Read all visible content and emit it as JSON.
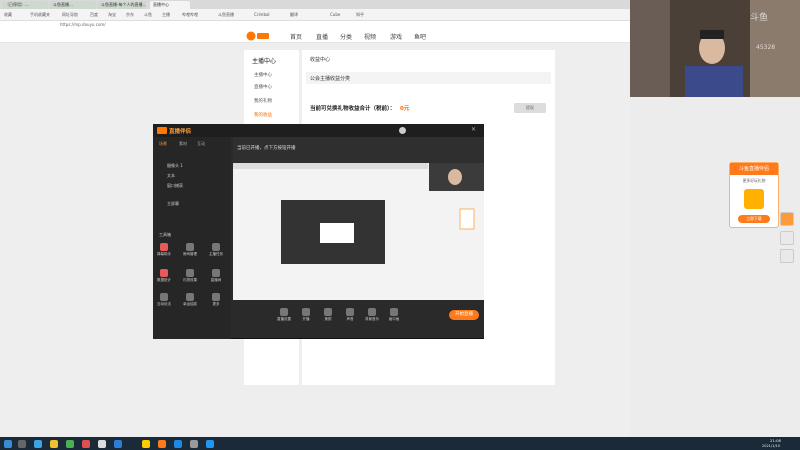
{
  "browser": {
    "tabs": [
      "（已停用）...",
      "斗鱼直播...",
      "斗鱼直播-每个人的直播...",
      "直播中心"
    ],
    "bookmarks": [
      "收藏",
      "手机收藏夹",
      "网址导航",
      "百度",
      "淘宝",
      "京东",
      "斗鱼",
      "主播",
      "哔哩哔哩",
      "斗鱼直播",
      "Crimbal",
      "翻译",
      "Cube",
      "知乎"
    ],
    "address": "https://mp.douyu.com/"
  },
  "site": {
    "nav": [
      "首页",
      "直播",
      "分类",
      "视频",
      "游戏",
      "鱼吧"
    ],
    "left_title": "主播中心",
    "left_items": [
      "主播中心",
      "直播中心",
      "我的礼物",
      "我的收益"
    ],
    "breadcrumb": "收益中心",
    "section_title": "公会主播收益分类",
    "earnings_label": "当前可兑换礼物收益合计（税前）：",
    "earnings_value": "0元",
    "withdraw_button": "提现"
  },
  "obs": {
    "app_title": "直播伴侣",
    "side_tabs": [
      "场景",
      "素材",
      "互动"
    ],
    "scenes": [
      "摄像头 1",
      "文本",
      "窗口捕获",
      "主屏幕"
    ],
    "toolbox_title": "工具箱",
    "tools": [
      "弹幕助手",
      "房间管理",
      "主播任务",
      "数据统计",
      "礼物效果",
      "直播间",
      "互动玩法",
      "幸运抽奖",
      "更多"
    ],
    "bottom_tools": [
      "直播设置",
      "开播",
      "美颜",
      "声音",
      "背景音乐",
      "画中画"
    ],
    "start_button": "开始直播",
    "preview_caption": "当前已开播，点下方按钮开播"
  },
  "promo": {
    "title": "斗鱼直播伴侣",
    "subtitle": "更多好玩礼物",
    "cta": "立即下载"
  },
  "webcam": {
    "overlay_text": "斗鱼",
    "room": "45328"
  },
  "taskbar": {
    "clock": "21:08",
    "date": "2021/1/10"
  }
}
